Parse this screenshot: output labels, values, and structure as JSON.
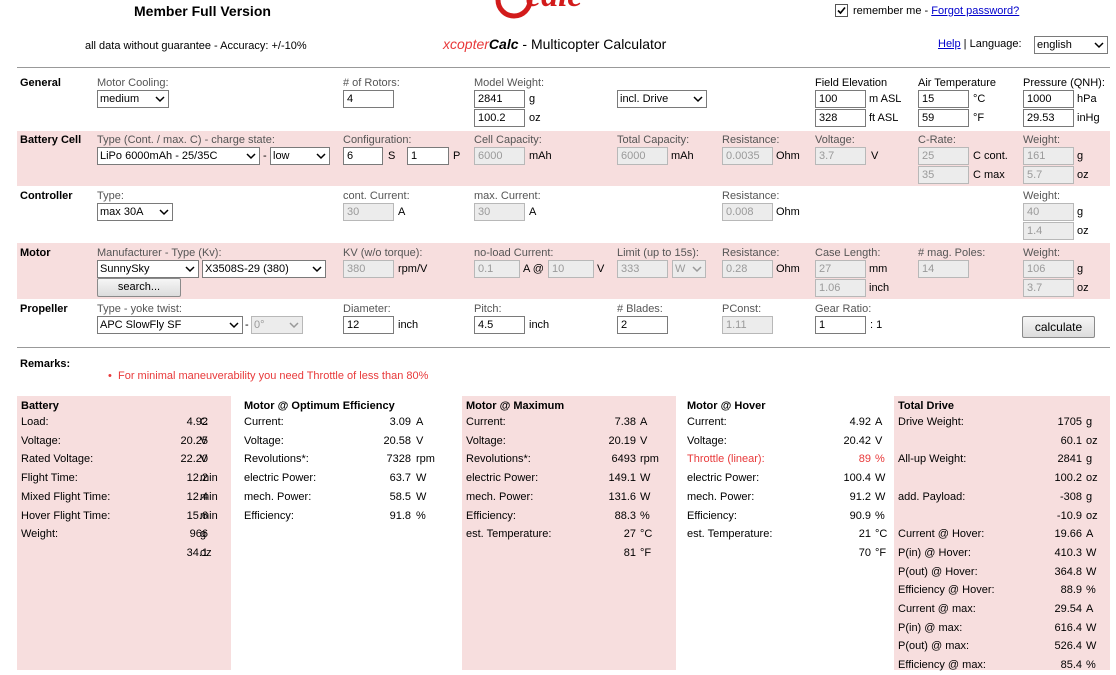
{
  "header": {
    "member": "Member Full Version",
    "disclaimer": "all data without guarantee - Accuracy: +/-10%",
    "logo_text": "eCalc",
    "app_prefix": "xcopter",
    "app_bold": "Calc",
    "app_suffix": " - Multicopter Calculator",
    "remember_label": "remember me - ",
    "forgot_link": "Forgot password?",
    "help_link": "Help",
    "language_label": " | Language:",
    "language_value": "english",
    "remember_checked": true
  },
  "general": {
    "title": "General",
    "motor_cooling_label": "Motor Cooling:",
    "motor_cooling_value": "medium",
    "rotors_label": "# of Rotors:",
    "rotors_value": "4",
    "model_weight_label": "Model Weight:",
    "model_weight_g": "2841",
    "model_weight_g_unit": "g",
    "model_weight_oz": "100.2",
    "model_weight_oz_unit": "oz",
    "weight_mode": "incl. Drive",
    "field_elev_label": "Field Elevation",
    "field_elev_m": "100",
    "field_elev_m_unit": "m ASL",
    "field_elev_ft": "328",
    "field_elev_ft_unit": "ft ASL",
    "air_temp_label": "Air Temperature",
    "air_temp_c": "15",
    "air_temp_c_unit": "°C",
    "air_temp_f": "59",
    "air_temp_f_unit": "°F",
    "pressure_label": "Pressure (QNH):",
    "pressure_hpa": "1000",
    "pressure_hpa_unit": "hPa",
    "pressure_inhg": "29.53",
    "pressure_inhg_unit": "inHg"
  },
  "battery": {
    "title": "Battery Cell",
    "type_label": "Type (Cont. / max. C) - charge state:",
    "type_value": "LiPo 6000mAh - 25/35C",
    "dash": "-",
    "charge_value": "low",
    "config_label": "Configuration:",
    "config_s": "6",
    "s_label": "S",
    "config_p": "1",
    "p_label": "P",
    "cell_cap_label": "Cell Capacity:",
    "cell_cap_value": "6000",
    "cell_cap_unit": "mAh",
    "total_cap_label": "Total Capacity:",
    "total_cap_value": "6000",
    "total_cap_unit": "mAh",
    "resistance_label": "Resistance:",
    "resistance_value": "0.0035",
    "resistance_unit": "Ohm",
    "voltage_label": "Voltage:",
    "voltage_value": "3.7",
    "voltage_unit": "V",
    "crate_label": "C-Rate:",
    "crate_cont": "25",
    "crate_cont_unit": "C cont.",
    "crate_max": "35",
    "crate_max_unit": "C max",
    "weight_label": "Weight:",
    "weight_g": "161",
    "weight_g_unit": "g",
    "weight_oz": "5.7",
    "weight_oz_unit": "oz"
  },
  "controller": {
    "title": "Controller",
    "type_label": "Type:",
    "type_value": "max 30A",
    "cont_label": "cont. Current:",
    "cont_value": "30",
    "cont_unit": "A",
    "max_label": "max. Current:",
    "max_value": "30",
    "max_unit": "A",
    "resistance_label": "Resistance:",
    "resistance_value": "0.008",
    "resistance_unit": "Ohm",
    "weight_label": "Weight:",
    "weight_g": "40",
    "weight_g_unit": "g",
    "weight_oz": "1.4",
    "weight_oz_unit": "oz"
  },
  "motor": {
    "title": "Motor",
    "mfr_label": "Manufacturer - Type (Kv):",
    "mfr_value": "SunnySky",
    "type_value": "X3508S-29 (380)",
    "search_button": "search...",
    "kv_label": "KV (w/o torque):",
    "kv_value": "380",
    "kv_unit": "rpm/V",
    "noload_label": "no-load Current:",
    "noload_value": "0.1",
    "noload_unit": "A @",
    "noload_v": "10",
    "noload_v_unit": "V",
    "limit_label": "Limit (up to 15s):",
    "limit_value": "333",
    "limit_unit": "W",
    "resistance_label": "Resistance:",
    "resistance_value": "0.28",
    "resistance_unit": "Ohm",
    "case_label": "Case Length:",
    "case_mm": "27",
    "case_mm_unit": "mm",
    "case_inch": "1.06",
    "case_inch_unit": "inch",
    "poles_label": "# mag. Poles:",
    "poles_value": "14",
    "weight_label": "Weight:",
    "weight_g": "106",
    "weight_g_unit": "g",
    "weight_oz": "3.7",
    "weight_oz_unit": "oz"
  },
  "propeller": {
    "title": "Propeller",
    "type_label": "Type - yoke twist:",
    "type_value": "APC SlowFly SF",
    "dash": "-",
    "twist_value": "0°",
    "diameter_label": "Diameter:",
    "diameter_value": "12",
    "diameter_unit": "inch",
    "pitch_label": "Pitch:",
    "pitch_value": "4.5",
    "pitch_unit": "inch",
    "blades_label": "# Blades:",
    "blades_value": "2",
    "pconst_label": "PConst:",
    "pconst_value": "1.11",
    "gear_label": "Gear Ratio:",
    "gear_value": "1",
    "gear_unit": ": 1",
    "calculate_button": "calculate"
  },
  "remarks": {
    "title": "Remarks:",
    "items": [
      "For minimal maneuverability you need Throttle of less than 80%"
    ]
  },
  "results": {
    "battery": {
      "title": "Battery",
      "rows": [
        {
          "k": "Load:",
          "v": "4.92",
          "u": "C"
        },
        {
          "k": "Voltage:",
          "v": "20.25",
          "u": "V"
        },
        {
          "k": "Rated Voltage:",
          "v": "22.20",
          "u": "V"
        },
        {
          "k": "Flight Time:",
          "v": "12.2",
          "u": "min"
        },
        {
          "k": "Mixed Flight Time:",
          "v": "12.4",
          "u": "min"
        },
        {
          "k": "Hover Flight Time:",
          "v": "15.6",
          "u": "min"
        },
        {
          "k": "Weight:",
          "v": "966",
          "u": "g"
        },
        {
          "k": "",
          "v": "34.1",
          "u": "oz"
        }
      ]
    },
    "optimum": {
      "title": "Motor @ Optimum Efficiency",
      "rows": [
        {
          "k": "Current:",
          "v": "3.09",
          "u": "A"
        },
        {
          "k": "Voltage:",
          "v": "20.58",
          "u": "V"
        },
        {
          "k": "Revolutions*:",
          "v": "7328",
          "u": "rpm"
        },
        {
          "k": "electric Power:",
          "v": "63.7",
          "u": "W"
        },
        {
          "k": "mech. Power:",
          "v": "58.5",
          "u": "W"
        },
        {
          "k": "Efficiency:",
          "v": "91.8",
          "u": "%"
        }
      ]
    },
    "maximum": {
      "title": "Motor @ Maximum",
      "rows": [
        {
          "k": "Current:",
          "v": "7.38",
          "u": "A"
        },
        {
          "k": "Voltage:",
          "v": "20.19",
          "u": "V"
        },
        {
          "k": "Revolutions*:",
          "v": "6493",
          "u": "rpm"
        },
        {
          "k": "electric Power:",
          "v": "149.1",
          "u": "W"
        },
        {
          "k": "mech. Power:",
          "v": "131.6",
          "u": "W"
        },
        {
          "k": "Efficiency:",
          "v": "88.3",
          "u": "%"
        },
        {
          "k": "est. Temperature:",
          "v": "27",
          "u": "°C"
        },
        {
          "k": "",
          "v": "81",
          "u": "°F"
        }
      ]
    },
    "hover": {
      "title": "Motor @ Hover",
      "rows": [
        {
          "k": "Current:",
          "v": "4.92",
          "u": "A"
        },
        {
          "k": "Voltage:",
          "v": "20.42",
          "u": "V"
        },
        {
          "k": "Throttle (linear):",
          "v": "89",
          "u": "%",
          "red": true
        },
        {
          "k": "electric Power:",
          "v": "100.4",
          "u": "W"
        },
        {
          "k": "mech. Power:",
          "v": "91.2",
          "u": "W"
        },
        {
          "k": "Efficiency:",
          "v": "90.9",
          "u": "%"
        },
        {
          "k": "est. Temperature:",
          "v": "21",
          "u": "°C"
        },
        {
          "k": "",
          "v": "70",
          "u": "°F"
        }
      ]
    },
    "total": {
      "title": "Total Drive",
      "rows": [
        {
          "k": "Drive Weight:",
          "v": "1705",
          "u": "g"
        },
        {
          "k": "",
          "v": "60.1",
          "u": "oz"
        },
        {
          "k": "All-up Weight:",
          "v": "2841",
          "u": "g"
        },
        {
          "k": "",
          "v": "100.2",
          "u": "oz"
        },
        {
          "k": "add. Payload:",
          "v": "-308",
          "u": "g"
        },
        {
          "k": "",
          "v": "-10.9",
          "u": "oz"
        },
        {
          "k": "Current @ Hover:",
          "v": "19.66",
          "u": "A"
        },
        {
          "k": "P(in) @ Hover:",
          "v": "410.3",
          "u": "W"
        },
        {
          "k": "P(out) @ Hover:",
          "v": "364.8",
          "u": "W"
        },
        {
          "k": "Efficiency @ Hover:",
          "v": "88.9",
          "u": "%"
        },
        {
          "k": "Current @ max:",
          "v": "29.54",
          "u": "A"
        },
        {
          "k": "P(in) @ max:",
          "v": "616.4",
          "u": "W"
        },
        {
          "k": "P(out) @ max:",
          "v": "526.4",
          "u": "W"
        },
        {
          "k": "Efficiency @ max:",
          "v": "85.4",
          "u": "%"
        }
      ]
    }
  }
}
